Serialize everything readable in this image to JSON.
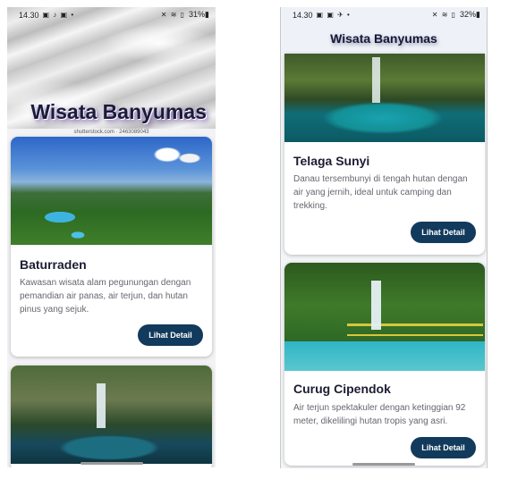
{
  "phone_a": {
    "status": {
      "time": "14.30",
      "icons_left": "▣ ♪ ▣ •",
      "icons_right": "✕ ≋ ▯",
      "battery": "31%▮"
    },
    "hero": {
      "title": "Wisata Banyumas",
      "watermark": "shutterstock.com · 2463089043"
    },
    "cards": [
      {
        "title": "Baturraden",
        "description": "Kawasan wisata alam pegunungan dengan pemandian air panas, air terjun, dan hutan pinus yang sejuk.",
        "button": "Lihat Detail"
      }
    ]
  },
  "phone_b": {
    "status": {
      "time": "14.30",
      "icons_left": "▣ ▣ ✈ •",
      "icons_right": "✕ ≋ ▯",
      "battery": "32%▮"
    },
    "appbar": {
      "title": "Wisata Banyumas"
    },
    "cards": [
      {
        "title": "Telaga Sunyi",
        "description": "Danau tersembunyi di tengah hutan dengan air yang jernih, ideal untuk camping dan trekking.",
        "button": "Lihat Detail"
      },
      {
        "title": "Curug Cipendok",
        "description": "Air terjun spektakuler dengan ketinggian 92 meter, dikelilingi hutan tropis yang asri.",
        "button": "Lihat Detail"
      }
    ]
  },
  "colors": {
    "button": "#123a5c",
    "title": "#1c1c33",
    "description": "#666670"
  },
  "icons": [
    "photo-icon",
    "music-icon",
    "mute-icon",
    "wifi-icon",
    "signal-icon",
    "battery-icon"
  ]
}
